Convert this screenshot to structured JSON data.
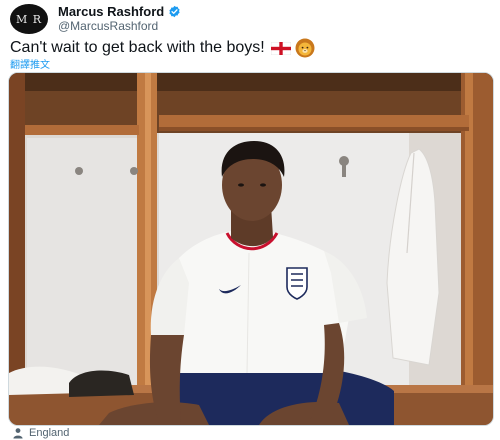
{
  "author": {
    "name": "Marcus Rashford",
    "handle": "@MarcusRashford",
    "avatar_monogram": "M R",
    "verified": true
  },
  "tweet": {
    "text": "Can't wait to get back with the boys!",
    "emojis": [
      "england-flag",
      "lion-face"
    ],
    "translate_label": "翻譯推文"
  },
  "location": {
    "label": "England",
    "icon": "person-pin-icon"
  },
  "colors": {
    "accent": "#1d9bf0",
    "text": "#0f1419",
    "muted": "#536471",
    "jersey_navy": "#1d2a5c",
    "locker_wood": "#b8743e"
  }
}
